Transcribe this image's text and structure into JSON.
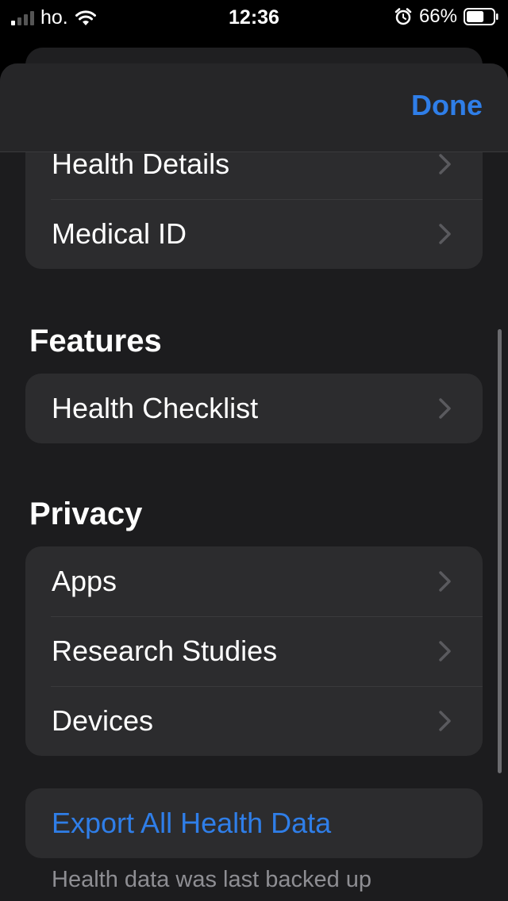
{
  "status_bar": {
    "carrier": "ho.",
    "time": "12:36",
    "battery_percent": "66%",
    "battery_level": 0.66,
    "signal_bars_active": 1
  },
  "nav": {
    "done_label": "Done"
  },
  "top_group": {
    "items": [
      {
        "label": "Health Details"
      },
      {
        "label": "Medical ID"
      }
    ]
  },
  "features": {
    "header": "Features",
    "items": [
      {
        "label": "Health Checklist"
      }
    ]
  },
  "privacy": {
    "header": "Privacy",
    "items": [
      {
        "label": "Apps"
      },
      {
        "label": "Research Studies"
      },
      {
        "label": "Devices"
      }
    ]
  },
  "export": {
    "label": "Export All Health Data",
    "footnote": "Health data was last backed up"
  },
  "colors": {
    "accent": "#2f7ee8",
    "background": "#000000",
    "sheet": "#1c1c1e",
    "group": "#2c2c2e",
    "chevron": "#5a5a5e"
  },
  "icons": [
    "cellular-signal-icon",
    "wifi-icon",
    "alarm-clock-icon",
    "battery-icon",
    "chevron-right-icon"
  ]
}
